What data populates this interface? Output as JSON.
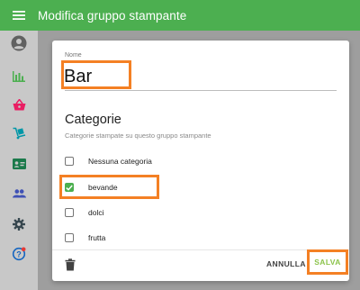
{
  "appbar": {
    "title": "Modifica gruppo stampante",
    "menu_icon": "hamburger-menu-icon",
    "color": "#4caf50"
  },
  "sidebar": {
    "icons": [
      "account-icon",
      "bar-chart-icon",
      "basket-icon",
      "delivery-icon",
      "id-card-icon",
      "people-icon",
      "gear-icon",
      "help-icon"
    ]
  },
  "form": {
    "name_label": "Nome",
    "name_value": "Bar",
    "section_title": "Categorie",
    "section_subtitle": "Categorie stampate su questo gruppo stampante",
    "categories": [
      {
        "label": "Nessuna categoria",
        "checked": false
      },
      {
        "label": "bevande",
        "checked": true
      },
      {
        "label": "dolci",
        "checked": false
      },
      {
        "label": "frutta",
        "checked": false
      }
    ]
  },
  "actions": {
    "delete_icon": "trash-icon",
    "cancel_label": "ANNULLA",
    "save_label": "SALVA"
  },
  "colors": {
    "accent": "#4caf50",
    "highlight": "#f48024",
    "save_text": "#8bc34a"
  }
}
